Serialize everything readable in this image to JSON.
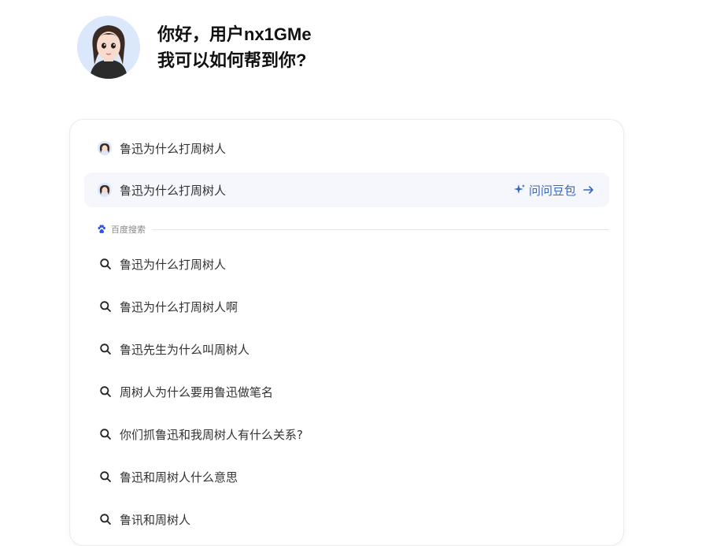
{
  "header": {
    "greeting_line1": "你好，用户nx1GMe",
    "greeting_line2": "我可以如何帮到你?"
  },
  "suggestions": {
    "items": [
      {
        "text": "鲁迅为什么打周树人"
      },
      {
        "text": "鲁迅为什么打周树人"
      }
    ],
    "ask_label": "问问豆包"
  },
  "baidu": {
    "section_label": "百度搜索",
    "results": [
      "鲁迅为什么打周树人",
      "鲁迅为什么打周树人啊",
      "鲁迅先生为什么叫周树人",
      "周树人为什么要用鲁迅做笔名",
      "你们抓鲁迅和我周树人有什么关系?",
      "鲁迅和周树人什么意思",
      "鲁讯和周树人"
    ]
  },
  "colors": {
    "accent": "#3366cc",
    "highlight_bg": "#f6f7fc"
  },
  "icons": [
    "avatar",
    "sparkle-icon",
    "arrow-right-icon",
    "baidu-paw-icon",
    "search-icon"
  ]
}
